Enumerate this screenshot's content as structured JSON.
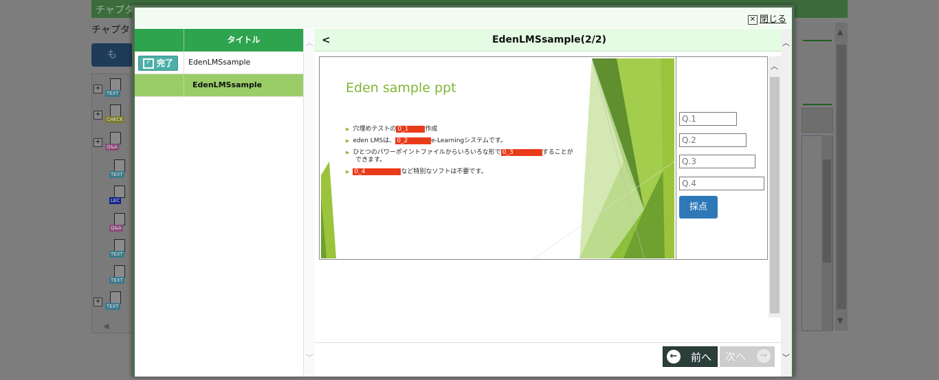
{
  "background": {
    "header_title": "チャプタ　　リ",
    "subtitle": "チャプタ",
    "button_label": "も",
    "tree_items": [
      {
        "tag": "TEXT",
        "tag_color": "#3a7a8a"
      },
      {
        "tag": "CHECK",
        "tag_color": "#7a7a2a"
      },
      {
        "tag": "Q&A",
        "tag_color": "#8a4a7a"
      },
      {
        "tag": "TEXT",
        "tag_color": "#3a7a8a"
      },
      {
        "tag": "LEC",
        "tag_color": "#14238a"
      },
      {
        "tag": "Q&A",
        "tag_color": "#8a4a7a"
      },
      {
        "tag": "TEXT",
        "tag_color": "#3a7a8a"
      },
      {
        "tag": "TEXT",
        "tag_color": "#3a7a8a"
      },
      {
        "tag": "TEXT",
        "tag_color": "#3a7a8a"
      }
    ]
  },
  "modal": {
    "close_label": "閉じる",
    "close_icon": "close-box-icon",
    "sidebar": {
      "header_title": "タイトル",
      "rows": [
        {
          "badge": "完了",
          "title": "EdenLMSsample",
          "active": false
        },
        {
          "badge": "",
          "title": "EdenLMSsample",
          "active": true
        }
      ]
    },
    "header": {
      "back_label": "<",
      "title": "EdenLMSsample(2/2)"
    },
    "slide": {
      "title": "Eden sample ppt",
      "bullets": [
        {
          "before": "穴埋めテストの",
          "blank": "0_1",
          "after": "作成"
        },
        {
          "before": "eden LMSは、",
          "blank": "0_2",
          "after": "e-Learningシステムです。"
        },
        {
          "before": "ひとつのパワーポイントファイルからいろいろな形で",
          "blank": "0_3",
          "after": "することが"
        },
        {
          "before": "できます。",
          "blank": "",
          "after": ""
        },
        {
          "before": "",
          "blank": "0_4",
          "after": "など特別なソフトは不要です。"
        }
      ]
    },
    "quiz": {
      "q1": "Q.1",
      "q2": "Q.2",
      "q3": "Q.3",
      "q4": "Q.4",
      "score_label": "採点"
    },
    "footer": {
      "prev_label": "前へ",
      "next_label": "次へ"
    },
    "colors": {
      "green_header": "#2ea44f",
      "active_row": "#9acd68",
      "score_button": "#2f78b7",
      "redact": "#e93b1a"
    }
  }
}
